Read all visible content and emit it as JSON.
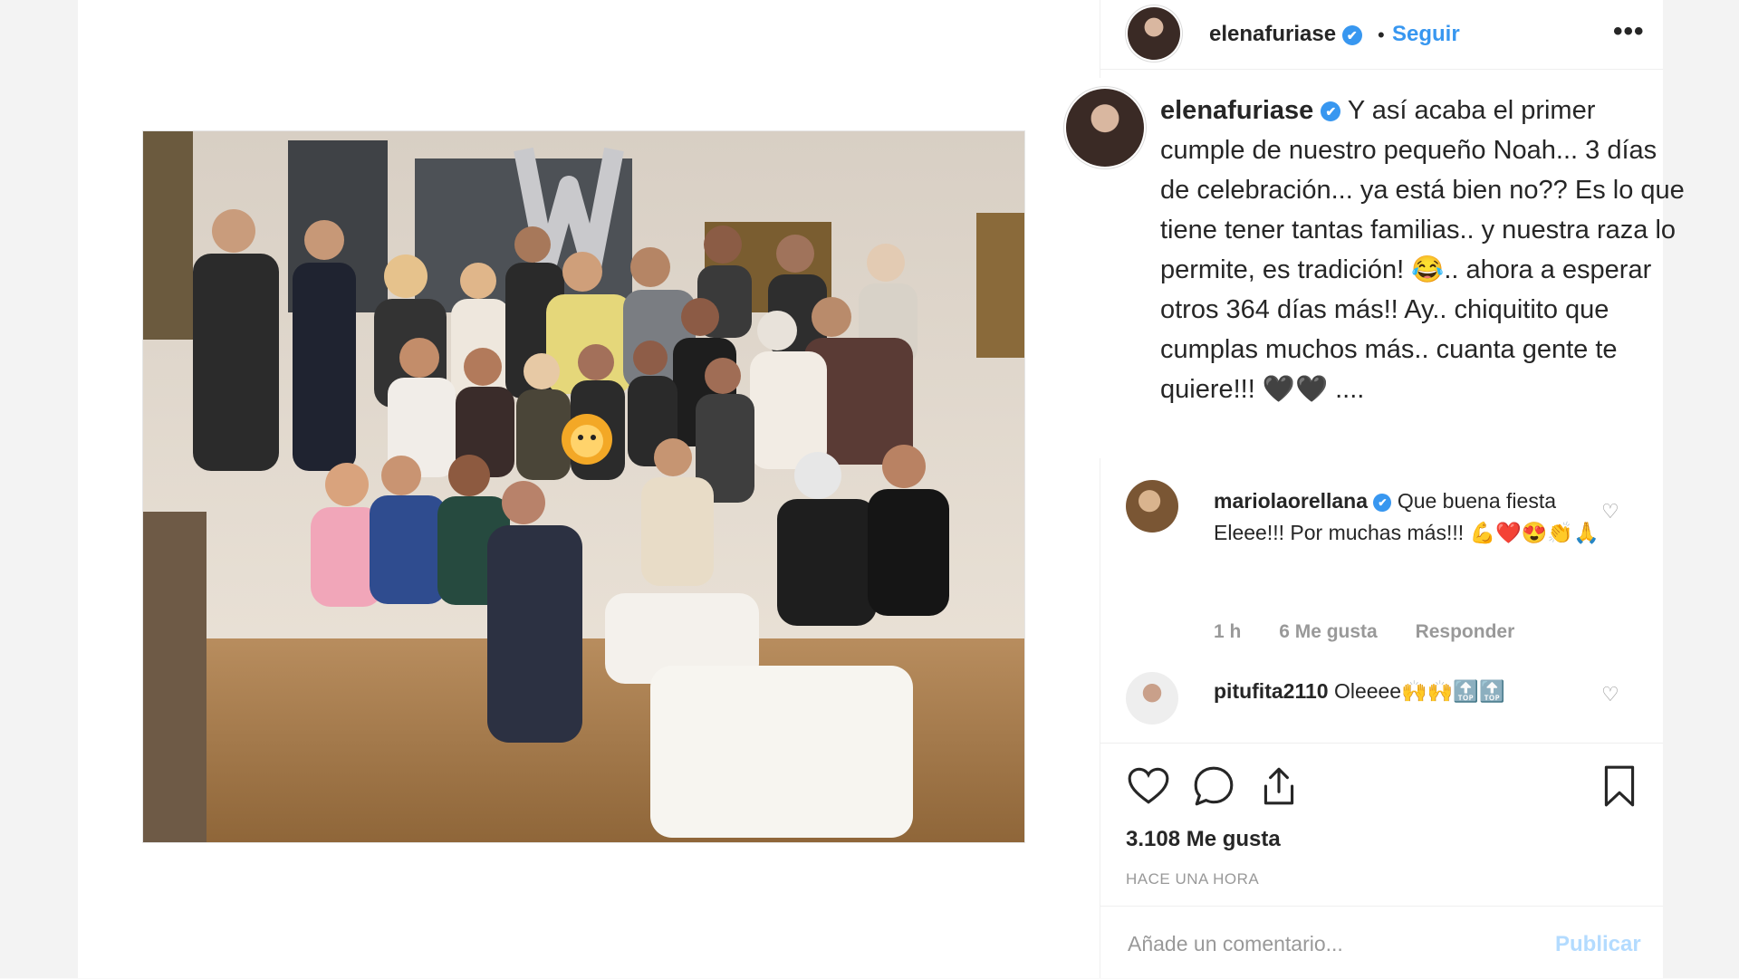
{
  "post": {
    "username": "elenafuriase",
    "verified_glyph": "✔",
    "separator": "•",
    "follow_label": "Seguir",
    "more_label": "•••",
    "caption": "Y así acaba el primer cumple de nuestro pequeño Noah... 3 días de celebración... ya está bien no?? Es lo que tiene tener tantas familias.. y nuestra raza lo permite, es tradición! 😂.. ahora a esperar otros 364 días más!! Ay.. chiquitito que cumplas muchos más.. cuanta gente te quiere!!! 🖤🖤 ...."
  },
  "comments": [
    {
      "username": "mariolaorellana",
      "text": "Que buena fiesta Eleee!!! Por muchas más!!! 💪❤️😍👏🙏",
      "time": "1 h",
      "likes": "6 Me gusta",
      "reply": "Responder"
    },
    {
      "username": "pitufita2110",
      "text": "Oleeee🙌🙌🔝🔝"
    }
  ],
  "actions": {
    "likes": "3.108 Me gusta",
    "timestamp": "HACE UNA HORA"
  },
  "add_comment": {
    "placeholder": "Añade un comentario...",
    "publish_label": "Publicar"
  },
  "icons": [
    "heart-icon",
    "comment-icon",
    "share-icon",
    "bookmark-icon",
    "more-options-icon",
    "verified-badge-icon"
  ],
  "colors": {
    "link": "#3897f0",
    "muted": "#999999",
    "publish_disabled": "#b3dbff"
  }
}
